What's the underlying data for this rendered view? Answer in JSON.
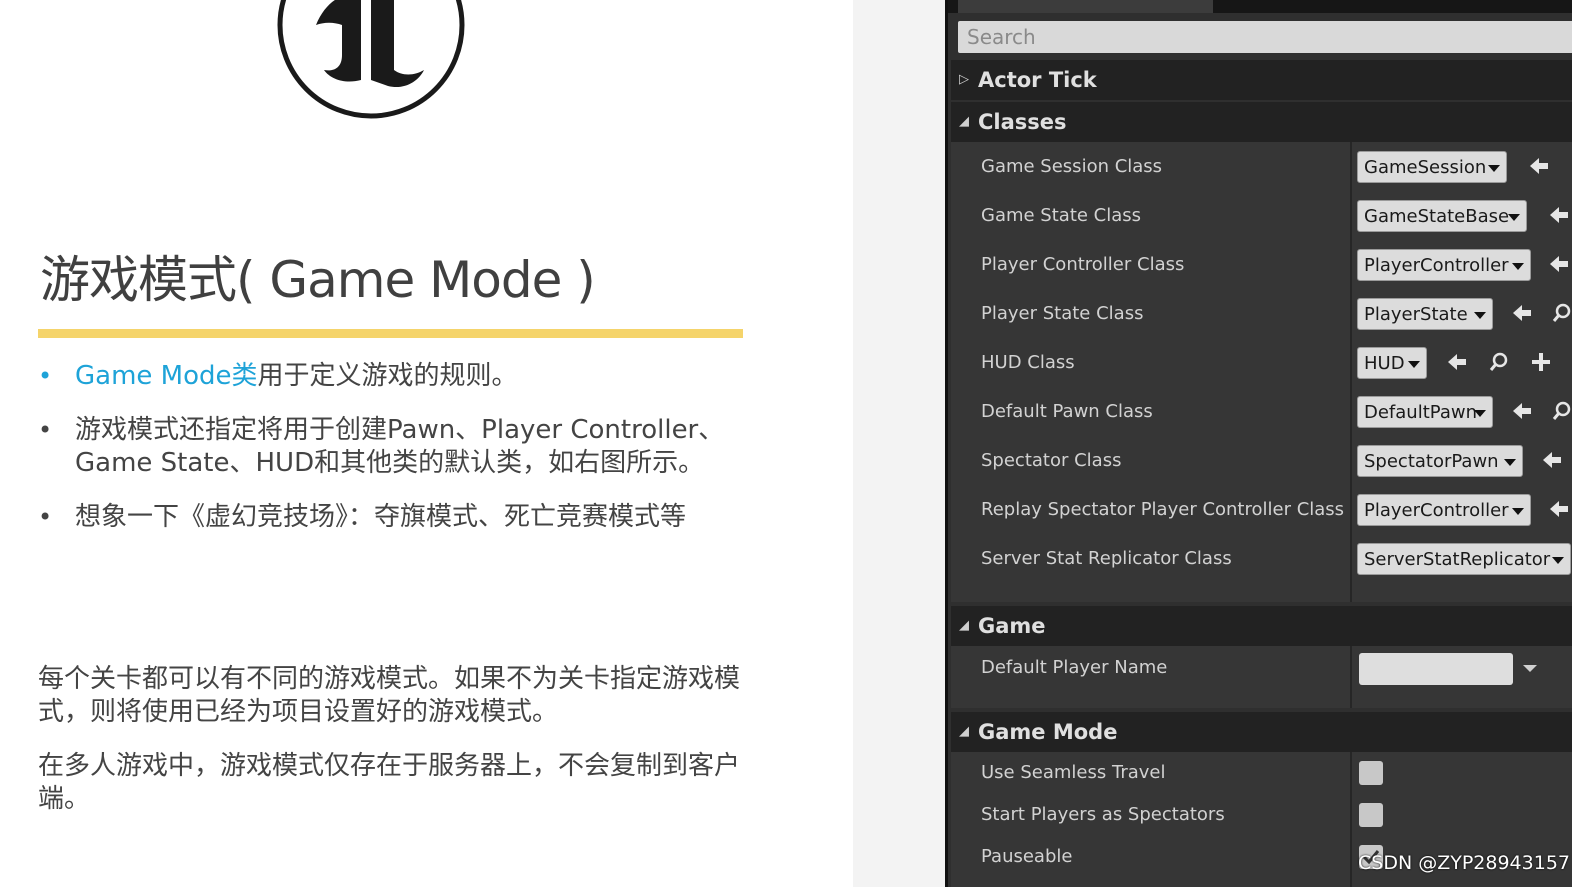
{
  "slide": {
    "title": "游戏模式( Game Mode )",
    "bullet1_accent": "Game Mode类",
    "bullet1_rest": "用于定义游戏的规则。",
    "bullet2": "游戏模式还指定将用于创建Pawn、Player Controller、Game State、HUD和其他类的默认类，如右图所示。",
    "bullet3": "想象一下《虚幻竞技场》：夺旗模式、死亡竞赛模式等",
    "bullet_symbol": "•",
    "para1": "每个关卡都可以有不同的游戏模式。如果不为关卡指定游戏模式，则将使用已经为项目设置好的游戏模式。",
    "para2": "在多人游戏中，游戏模式仅存在于服务器上，不会复制到客户端。",
    "colors": {
      "accent": "#1ea3d8",
      "rule": "#f5d46b",
      "text": "#444444"
    }
  },
  "panel": {
    "search_placeholder": "Search",
    "categories": {
      "actor_tick": "Actor Tick",
      "classes": "Classes",
      "game": "Game",
      "game_mode": "Game Mode"
    },
    "classes": [
      {
        "label": "Game Session Class",
        "value": "GameSession"
      },
      {
        "label": "Game State Class",
        "value": "GameStateBase"
      },
      {
        "label": "Player Controller Class",
        "value": "PlayerController"
      },
      {
        "label": "Player State Class",
        "value": "PlayerState"
      },
      {
        "label": "HUD Class",
        "value": "HUD"
      },
      {
        "label": "Default Pawn Class",
        "value": "DefaultPawn"
      },
      {
        "label": "Spectator Class",
        "value": "SpectatorPawn"
      },
      {
        "label": "Replay Spectator Player Controller Class",
        "value": "PlayerController"
      },
      {
        "label": "Server Stat Replicator Class",
        "value": "ServerStatReplicator"
      }
    ],
    "game": {
      "default_player_name_label": "Default Player Name",
      "default_player_name_value": ""
    },
    "game_mode": [
      {
        "label": "Use Seamless Travel",
        "checked": false
      },
      {
        "label": "Start Players as Spectators",
        "checked": false
      },
      {
        "label": "Pauseable",
        "checked": true
      }
    ]
  },
  "watermark": "CSDN @ZYP28943157"
}
